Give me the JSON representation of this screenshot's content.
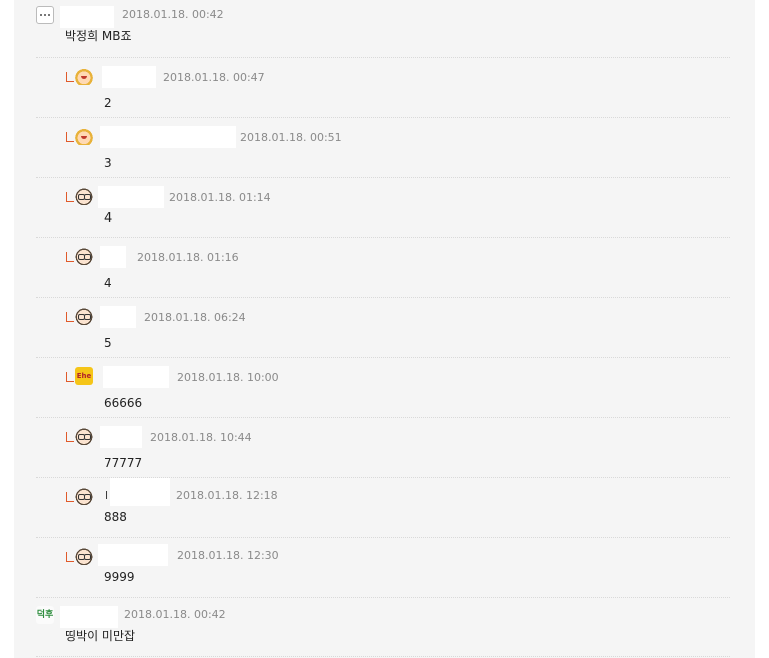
{
  "comments": [
    {
      "kind": "top",
      "avatar": "ghost-avatar",
      "date": "2018.01.18.  00:42",
      "body": "박정희 MB죠"
    },
    {
      "kind": "reply",
      "avatar": "blonde-avatar",
      "date": "2018.01.18.  00:47",
      "body": "2"
    },
    {
      "kind": "reply",
      "avatar": "blonde-avatar",
      "date": "2018.01.18.  00:51",
      "body": "3"
    },
    {
      "kind": "reply",
      "avatar": "glasses-avatar",
      "date": "2018.01.18.  01:14",
      "body": "4"
    },
    {
      "kind": "reply",
      "avatar": "glasses-avatar",
      "date": "2018.01.18.  01:16",
      "body": "4"
    },
    {
      "kind": "reply",
      "avatar": "glasses-avatar",
      "date": "2018.01.18.  06:24",
      "body": "5"
    },
    {
      "kind": "reply",
      "avatar": "sign-avatar",
      "avatar_text": "Ehe",
      "date": "2018.01.18.  10:00",
      "body": "66666"
    },
    {
      "kind": "reply",
      "avatar": "glasses-avatar",
      "date": "2018.01.18.  10:44",
      "body": "77777"
    },
    {
      "kind": "reply",
      "avatar": "glasses-avatar",
      "date": "2018.01.18.  12:18",
      "body": "888",
      "nick_fragment": "l"
    },
    {
      "kind": "reply",
      "avatar": "glasses-avatar",
      "date": "2018.01.18.  12:30",
      "body": "9999"
    },
    {
      "kind": "top",
      "avatar": "deok-avatar",
      "avatar_text": "덕후",
      "date": "2018.01.18.  00:42",
      "body": "띵박이 미만잡"
    }
  ],
  "colors": {
    "panel_bg": "#f5f5f5",
    "reply_arrow": "#e05a2a",
    "date_text": "#8a8a8a"
  }
}
